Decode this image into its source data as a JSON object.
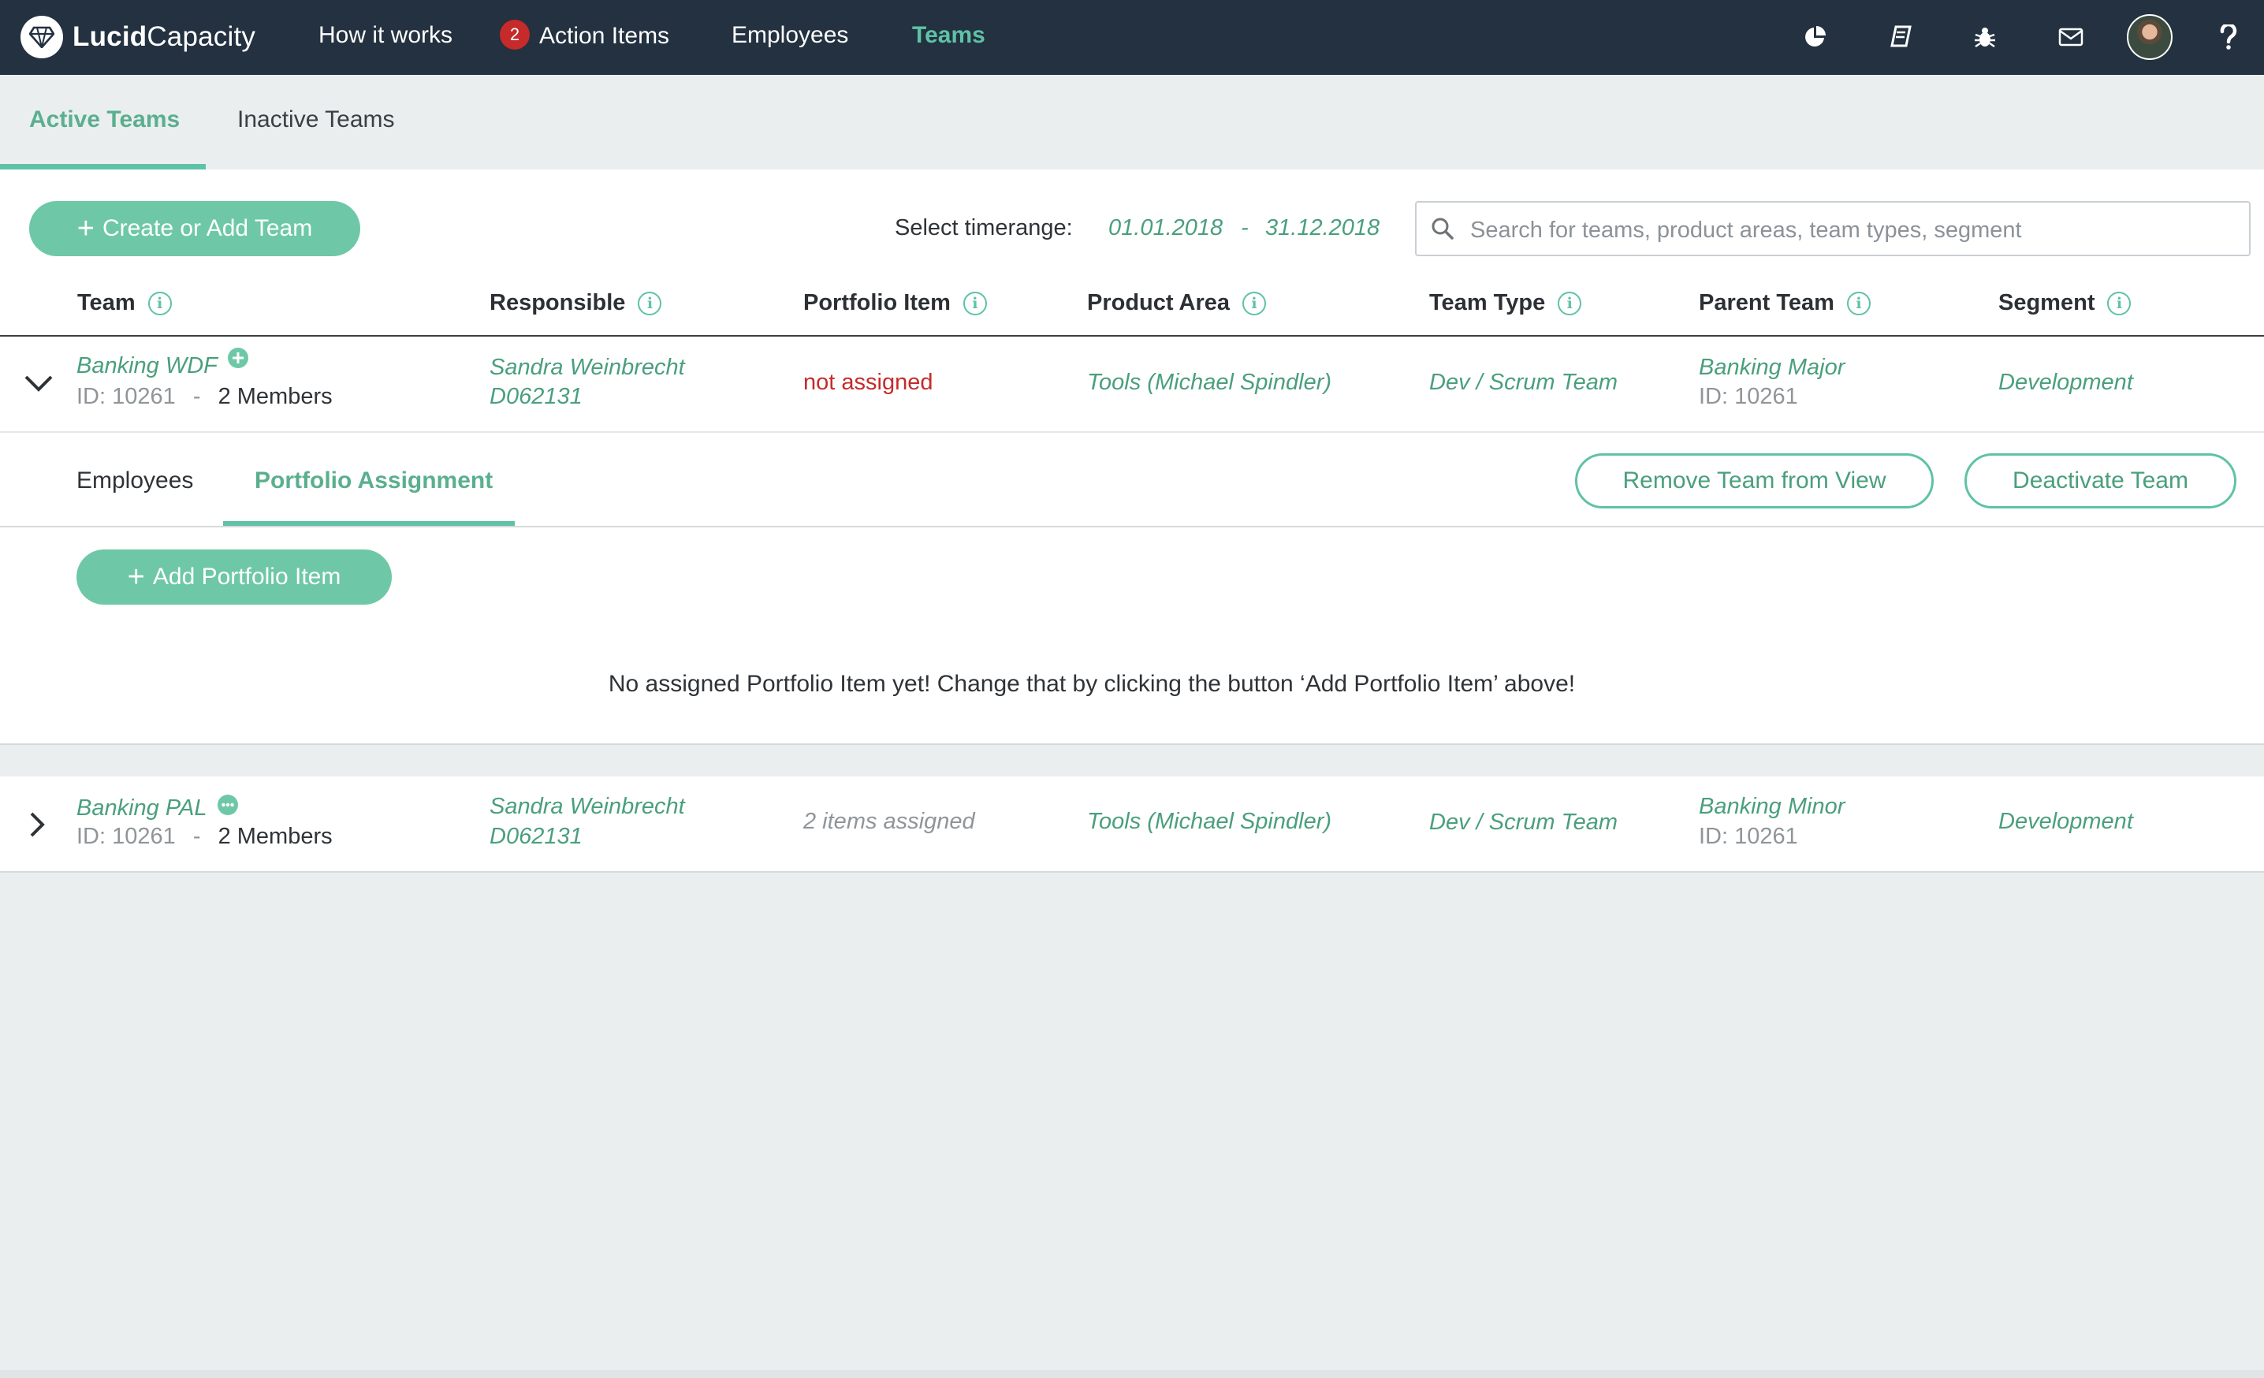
{
  "nav": {
    "logo_bold": "Lucid",
    "logo_light": "Capacity",
    "items": [
      {
        "label": "How it works"
      },
      {
        "label": "Action Items",
        "badge": "2"
      },
      {
        "label": "Employees"
      },
      {
        "label": "Teams"
      }
    ],
    "icons": [
      "pie-chart-icon",
      "book-icon",
      "bug-icon",
      "mail-icon",
      "avatar",
      "help-icon"
    ],
    "accent": "#5fc2a6",
    "background": "#233140"
  },
  "subtabs": [
    "Active Teams",
    "Inactive Teams"
  ],
  "toolbar": {
    "create_label": "Create or Add Team",
    "timerange_label": "Select timerange:",
    "date_from": "01.01.2018",
    "date_sep": "-",
    "date_to": "31.12.2018",
    "search_placeholder": "Search for teams, product areas, team types, segment"
  },
  "columns": [
    "Team",
    "Responsible",
    "Portfolio Item",
    "Product Area",
    "Team Type",
    "Parent Team",
    "Segment"
  ],
  "rows": [
    {
      "team": "Banking WDF",
      "team_id": "ID: 10261",
      "sep": "-",
      "members": "2 Members",
      "responsible_name": "Sandra Weinbrecht",
      "responsible_id": "D062131",
      "portfolio": "not assigned",
      "product_area": "Tools (Michael Spindler)",
      "team_type": "Dev / Scrum Team",
      "parent_team": "Banking Major",
      "parent_id": "ID: 10261",
      "segment": "Development",
      "expanded": true
    },
    {
      "team": "Banking PAL",
      "team_id": "ID: 10261",
      "sep": "-",
      "members": "2 Members",
      "responsible_name": "Sandra Weinbrecht",
      "responsible_id": "D062131",
      "portfolio": "2 items assigned",
      "product_area": "Tools (Michael Spindler)",
      "team_type": "Dev / Scrum Team",
      "parent_team": "Banking Minor",
      "parent_id": "ID: 10261",
      "segment": "Development",
      "expanded": false
    }
  ],
  "detail": {
    "tabs": [
      "Employees",
      "Portfolio Assignment"
    ],
    "remove_label": "Remove Team from View",
    "deactivate_label": "Deactivate Team",
    "add_label": "Add Portfolio Item",
    "empty_message": "No assigned Portfolio Item yet! Change that by clicking the button ‘Add Portfolio Item’ above!"
  }
}
